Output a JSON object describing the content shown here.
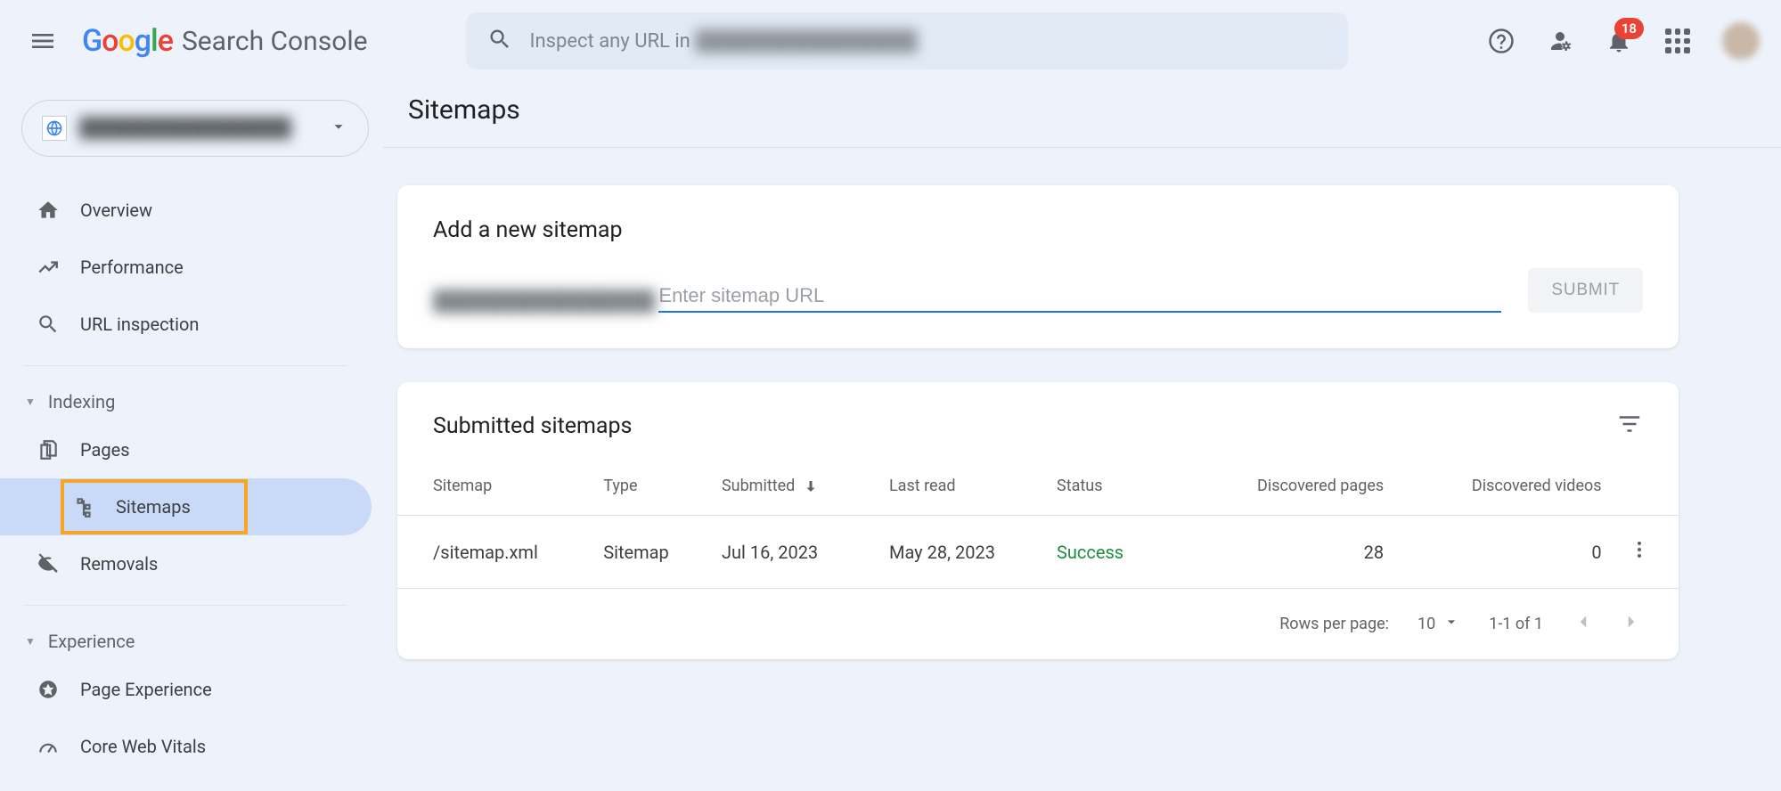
{
  "header": {
    "product_name": "Search Console",
    "search_prefix": "Inspect any URL in ",
    "search_domain_placeholder": "████████████████",
    "notification_count": "18"
  },
  "sidebar": {
    "property_name": "████████████████",
    "items_top": [
      {
        "label": "Overview",
        "icon": "home"
      },
      {
        "label": "Performance",
        "icon": "trend"
      },
      {
        "label": "URL inspection",
        "icon": "search"
      }
    ],
    "group_indexing": "Indexing",
    "items_indexing": [
      {
        "label": "Pages",
        "icon": "pages"
      },
      {
        "label": "Sitemaps",
        "icon": "sitemap",
        "active": true
      },
      {
        "label": "Removals",
        "icon": "removals"
      }
    ],
    "group_experience": "Experience",
    "items_experience": [
      {
        "label": "Page Experience",
        "icon": "page-exp"
      },
      {
        "label": "Core Web Vitals",
        "icon": "cwv"
      }
    ]
  },
  "page": {
    "title": "Sitemaps",
    "add_card": {
      "title": "Add a new sitemap",
      "prefix": "████████████████",
      "placeholder": "Enter sitemap URL",
      "submit": "SUBMIT"
    },
    "list_card": {
      "title": "Submitted sitemaps",
      "columns": {
        "sitemap": "Sitemap",
        "type": "Type",
        "submitted": "Submitted",
        "last_read": "Last read",
        "status": "Status",
        "pages": "Discovered pages",
        "videos": "Discovered videos"
      },
      "rows": [
        {
          "sitemap": "/sitemap.xml",
          "type": "Sitemap",
          "submitted": "Jul 16, 2023",
          "last_read": "May 28, 2023",
          "status": "Success",
          "pages": "28",
          "videos": "0"
        }
      ],
      "footer": {
        "rows_label": "Rows per page:",
        "rows_value": "10",
        "range": "1-1 of 1"
      }
    }
  }
}
